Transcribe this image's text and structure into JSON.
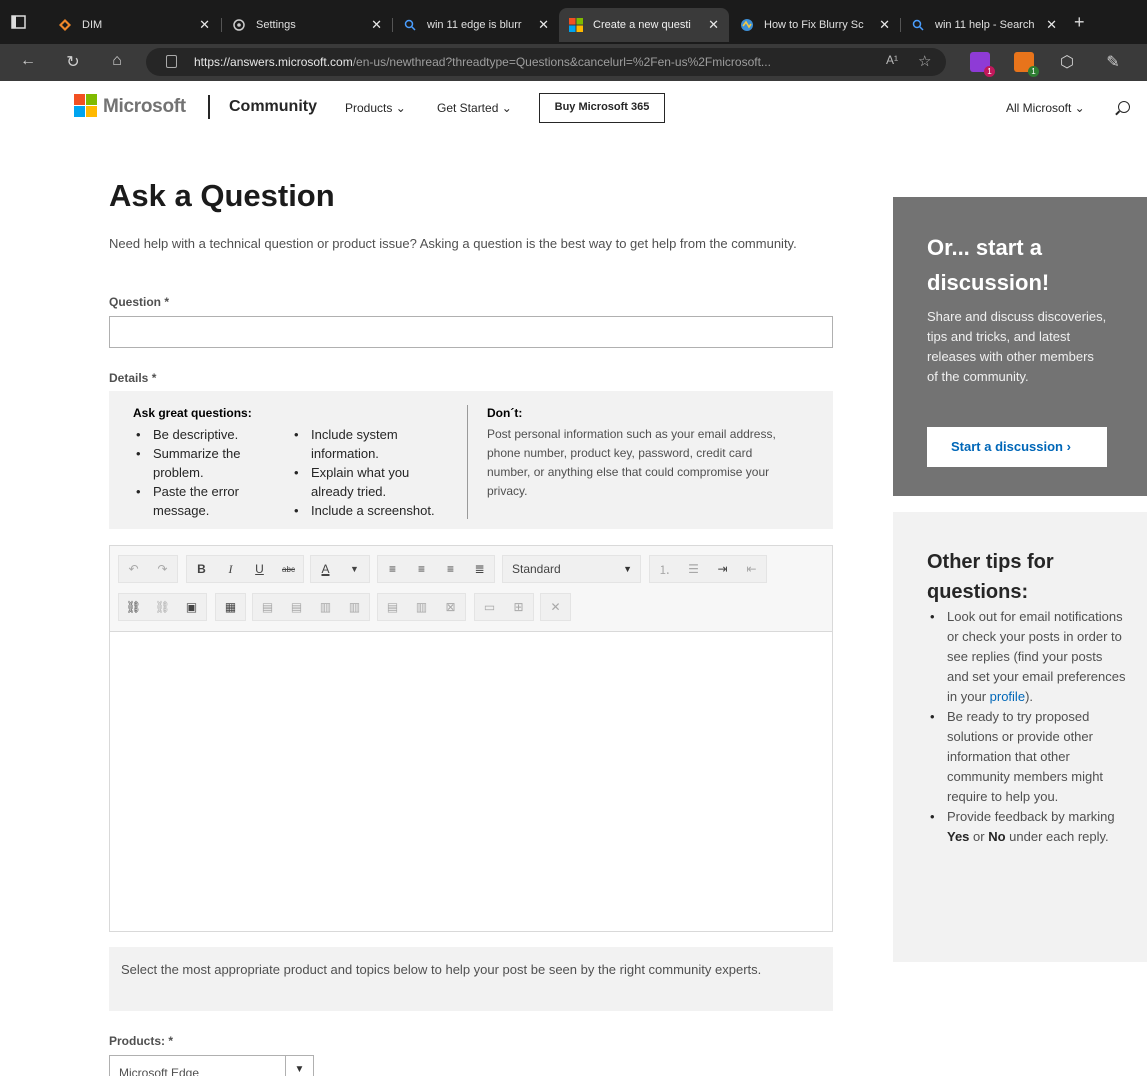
{
  "browser": {
    "tabs": [
      {
        "label": "DIM",
        "icon": "dim-icon"
      },
      {
        "label": "Settings",
        "icon": "gear-icon"
      },
      {
        "label": "win 11 edge is blurr",
        "icon": "search-icon"
      },
      {
        "label": "Create a new questi",
        "icon": "microsoft-icon"
      },
      {
        "label": "How to Fix Blurry Sc",
        "icon": "page-icon"
      },
      {
        "label": "win 11 help - Search",
        "icon": "search-icon"
      }
    ],
    "url_host": "https://answers.microsoft.com",
    "url_path": "/en-us/newthread?threadtype=Questions&cancelurl=%2Fen-us%2Fmicrosoft...",
    "read_aloud": "A¹",
    "ext_badge_1": "1",
    "ext_badge_2": "1"
  },
  "header": {
    "brand": "Microsoft",
    "community": "Community",
    "nav": [
      "Products ⌄",
      "Get Started ⌄"
    ],
    "buy_button": "Buy Microsoft 365",
    "all_microsoft": "All Microsoft ⌄"
  },
  "form": {
    "title": "Ask a Question",
    "intro": "Need help with a technical question or product issue? Asking a question is the best way to get help from the community.",
    "question_label": "Question",
    "details_label": "Details",
    "required_mark": "*",
    "tips_title": "Ask great questions:",
    "tips_col1": [
      "Be descriptive.",
      "Summarize the problem.",
      "Paste the error message."
    ],
    "tips_col2": [
      "Include system information.",
      "Explain what you already tried.",
      "Include a screenshot."
    ],
    "donts_title": "Don´t:",
    "donts_text": "Post personal information such as your email address, phone number, product key, password, credit card number, or anything else that could compromise your privacy.",
    "style_select": "Standard",
    "product_note": "Select the most appropriate product and topics below to help your post be seen by the right community experts.",
    "products_label": "Products:",
    "products_value": "Microsoft Edge"
  },
  "sidebar": {
    "discuss_title": "Or... start a discussion!",
    "discuss_text": "Share and discuss discoveries, tips and tricks, and latest releases with other members of the community.",
    "discuss_button": "Start a discussion ›",
    "tips_title": "Other tips for questions:",
    "tip1_a": "Look out for email notifications or check your posts in order to see replies (find your posts and set your email preferences in your ",
    "tip1_link": "profile",
    "tip1_b": ").",
    "tip2": "Be ready to try proposed solutions or provide other information that other community members might require to help you.",
    "tip3_a": "Provide feedback by marking ",
    "tip3_yes": "Yes",
    "tip3_or": " or ",
    "tip3_no": "No",
    "tip3_b": " under each reply."
  },
  "colors": {
    "accent": "#0067b8",
    "ms_red": "#f25022",
    "ms_green": "#7fba00",
    "ms_blue": "#00a4ef",
    "ms_yellow": "#ffb900"
  }
}
